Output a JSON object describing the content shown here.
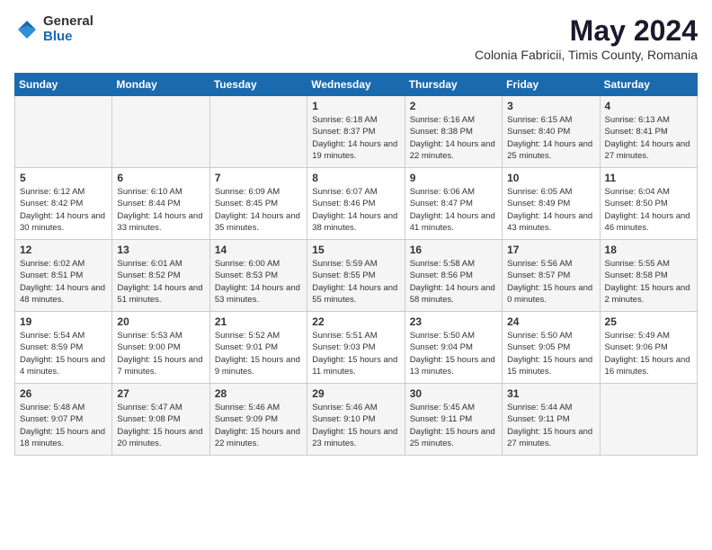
{
  "logo": {
    "general": "General",
    "blue": "Blue"
  },
  "title": {
    "main": "May 2024",
    "sub": "Colonia Fabricii, Timis County, Romania"
  },
  "headers": [
    "Sunday",
    "Monday",
    "Tuesday",
    "Wednesday",
    "Thursday",
    "Friday",
    "Saturday"
  ],
  "weeks": [
    [
      {
        "num": "",
        "info": ""
      },
      {
        "num": "",
        "info": ""
      },
      {
        "num": "",
        "info": ""
      },
      {
        "num": "1",
        "info": "Sunrise: 6:18 AM\nSunset: 8:37 PM\nDaylight: 14 hours\nand 19 minutes."
      },
      {
        "num": "2",
        "info": "Sunrise: 6:16 AM\nSunset: 8:38 PM\nDaylight: 14 hours\nand 22 minutes."
      },
      {
        "num": "3",
        "info": "Sunrise: 6:15 AM\nSunset: 8:40 PM\nDaylight: 14 hours\nand 25 minutes."
      },
      {
        "num": "4",
        "info": "Sunrise: 6:13 AM\nSunset: 8:41 PM\nDaylight: 14 hours\nand 27 minutes."
      }
    ],
    [
      {
        "num": "5",
        "info": "Sunrise: 6:12 AM\nSunset: 8:42 PM\nDaylight: 14 hours\nand 30 minutes."
      },
      {
        "num": "6",
        "info": "Sunrise: 6:10 AM\nSunset: 8:44 PM\nDaylight: 14 hours\nand 33 minutes."
      },
      {
        "num": "7",
        "info": "Sunrise: 6:09 AM\nSunset: 8:45 PM\nDaylight: 14 hours\nand 35 minutes."
      },
      {
        "num": "8",
        "info": "Sunrise: 6:07 AM\nSunset: 8:46 PM\nDaylight: 14 hours\nand 38 minutes."
      },
      {
        "num": "9",
        "info": "Sunrise: 6:06 AM\nSunset: 8:47 PM\nDaylight: 14 hours\nand 41 minutes."
      },
      {
        "num": "10",
        "info": "Sunrise: 6:05 AM\nSunset: 8:49 PM\nDaylight: 14 hours\nand 43 minutes."
      },
      {
        "num": "11",
        "info": "Sunrise: 6:04 AM\nSunset: 8:50 PM\nDaylight: 14 hours\nand 46 minutes."
      }
    ],
    [
      {
        "num": "12",
        "info": "Sunrise: 6:02 AM\nSunset: 8:51 PM\nDaylight: 14 hours\nand 48 minutes."
      },
      {
        "num": "13",
        "info": "Sunrise: 6:01 AM\nSunset: 8:52 PM\nDaylight: 14 hours\nand 51 minutes."
      },
      {
        "num": "14",
        "info": "Sunrise: 6:00 AM\nSunset: 8:53 PM\nDaylight: 14 hours\nand 53 minutes."
      },
      {
        "num": "15",
        "info": "Sunrise: 5:59 AM\nSunset: 8:55 PM\nDaylight: 14 hours\nand 55 minutes."
      },
      {
        "num": "16",
        "info": "Sunrise: 5:58 AM\nSunset: 8:56 PM\nDaylight: 14 hours\nand 58 minutes."
      },
      {
        "num": "17",
        "info": "Sunrise: 5:56 AM\nSunset: 8:57 PM\nDaylight: 15 hours\nand 0 minutes."
      },
      {
        "num": "18",
        "info": "Sunrise: 5:55 AM\nSunset: 8:58 PM\nDaylight: 15 hours\nand 2 minutes."
      }
    ],
    [
      {
        "num": "19",
        "info": "Sunrise: 5:54 AM\nSunset: 8:59 PM\nDaylight: 15 hours\nand 4 minutes."
      },
      {
        "num": "20",
        "info": "Sunrise: 5:53 AM\nSunset: 9:00 PM\nDaylight: 15 hours\nand 7 minutes."
      },
      {
        "num": "21",
        "info": "Sunrise: 5:52 AM\nSunset: 9:01 PM\nDaylight: 15 hours\nand 9 minutes."
      },
      {
        "num": "22",
        "info": "Sunrise: 5:51 AM\nSunset: 9:03 PM\nDaylight: 15 hours\nand 11 minutes."
      },
      {
        "num": "23",
        "info": "Sunrise: 5:50 AM\nSunset: 9:04 PM\nDaylight: 15 hours\nand 13 minutes."
      },
      {
        "num": "24",
        "info": "Sunrise: 5:50 AM\nSunset: 9:05 PM\nDaylight: 15 hours\nand 15 minutes."
      },
      {
        "num": "25",
        "info": "Sunrise: 5:49 AM\nSunset: 9:06 PM\nDaylight: 15 hours\nand 16 minutes."
      }
    ],
    [
      {
        "num": "26",
        "info": "Sunrise: 5:48 AM\nSunset: 9:07 PM\nDaylight: 15 hours\nand 18 minutes."
      },
      {
        "num": "27",
        "info": "Sunrise: 5:47 AM\nSunset: 9:08 PM\nDaylight: 15 hours\nand 20 minutes."
      },
      {
        "num": "28",
        "info": "Sunrise: 5:46 AM\nSunset: 9:09 PM\nDaylight: 15 hours\nand 22 minutes."
      },
      {
        "num": "29",
        "info": "Sunrise: 5:46 AM\nSunset: 9:10 PM\nDaylight: 15 hours\nand 23 minutes."
      },
      {
        "num": "30",
        "info": "Sunrise: 5:45 AM\nSunset: 9:11 PM\nDaylight: 15 hours\nand 25 minutes."
      },
      {
        "num": "31",
        "info": "Sunrise: 5:44 AM\nSunset: 9:11 PM\nDaylight: 15 hours\nand 27 minutes."
      },
      {
        "num": "",
        "info": ""
      }
    ]
  ]
}
